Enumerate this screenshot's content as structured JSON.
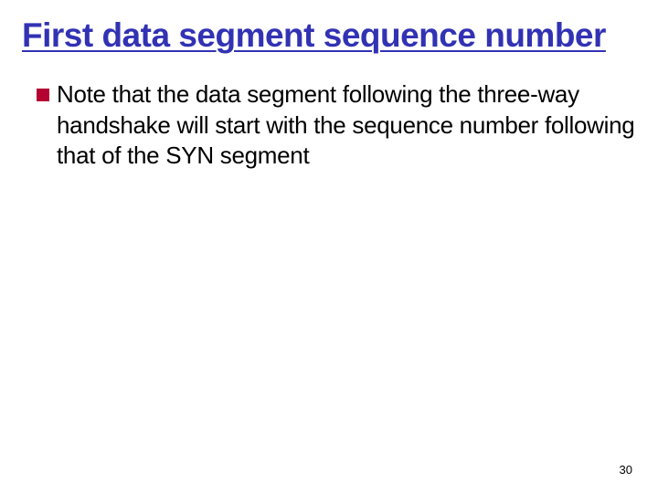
{
  "slide": {
    "title": "First data segment sequence number",
    "bullets": [
      "Note that the data segment following the three-way handshake will start with the sequence number following that of the SYN segment"
    ],
    "page_number": "30"
  }
}
